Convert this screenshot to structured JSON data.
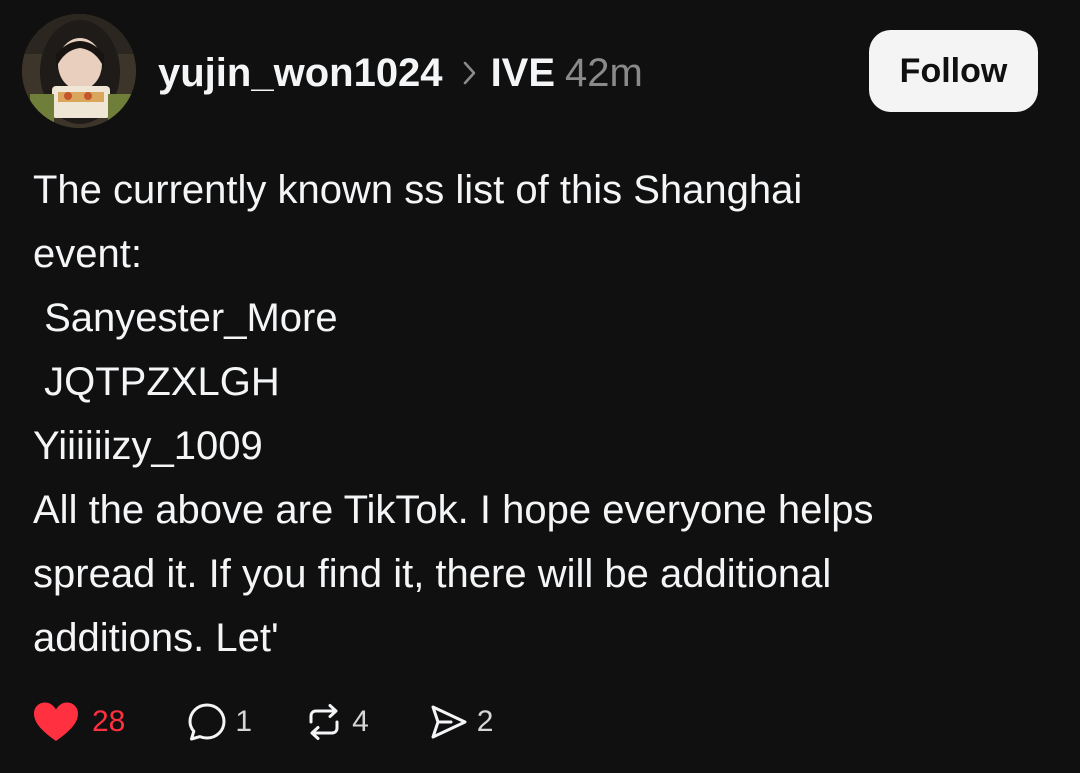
{
  "post": {
    "author": {
      "username": "yujin_won1024",
      "avatar": "profile photo of person eating food"
    },
    "community": "IVE",
    "timestamp": "42m",
    "follow_label": "Follow",
    "body_lines": [
      "The currently known ss list of this Shanghai",
      "event:",
      " Sanyester_More",
      " JQTPZXLGH",
      "Yiiiiiizy_1009",
      "All the above are TikTok. I hope everyone helps",
      "spread it. If you find it, there will be additional",
      "additions. Let'"
    ]
  },
  "actions": {
    "like": {
      "icon": "heart-icon",
      "count": "28",
      "liked": true,
      "color": "#ff3040"
    },
    "comment": {
      "icon": "comment-icon",
      "count": "1"
    },
    "repost": {
      "icon": "repost-icon",
      "count": "4"
    },
    "share": {
      "icon": "send-icon",
      "count": "2"
    }
  },
  "colors": {
    "background": "#101010",
    "text": "#f3f5f7",
    "muted": "#8a8a8a",
    "like": "#ff3040",
    "button_bg": "#f4f4f4"
  }
}
